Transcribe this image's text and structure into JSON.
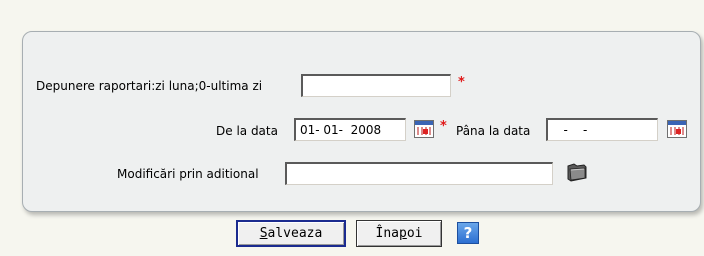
{
  "form": {
    "depunere_label": "Depunere raportari:zi luna;0-ultima zi",
    "depunere_value": "",
    "required_mark": "*",
    "de_la_label": "De la data",
    "de_la_value": "01- 01-  2008",
    "pana_la_label": "Pâna la data",
    "pana_la_value": "   -    -",
    "modificari_label": "Modificări prin aditional",
    "modificari_value": ""
  },
  "buttons": {
    "save_pre": "",
    "save_ul": "S",
    "save_post": "alveaza",
    "back_pre": "Îna",
    "back_ul": "p",
    "back_post": "oi",
    "help_label": "?"
  },
  "icons": {
    "calendar": "calendar-icon",
    "folder": "folder-icon",
    "help": "help-icon"
  },
  "colors": {
    "required": "#e01818",
    "help_button": "#2c6fd1",
    "primary_border": "#1b2b8f"
  }
}
